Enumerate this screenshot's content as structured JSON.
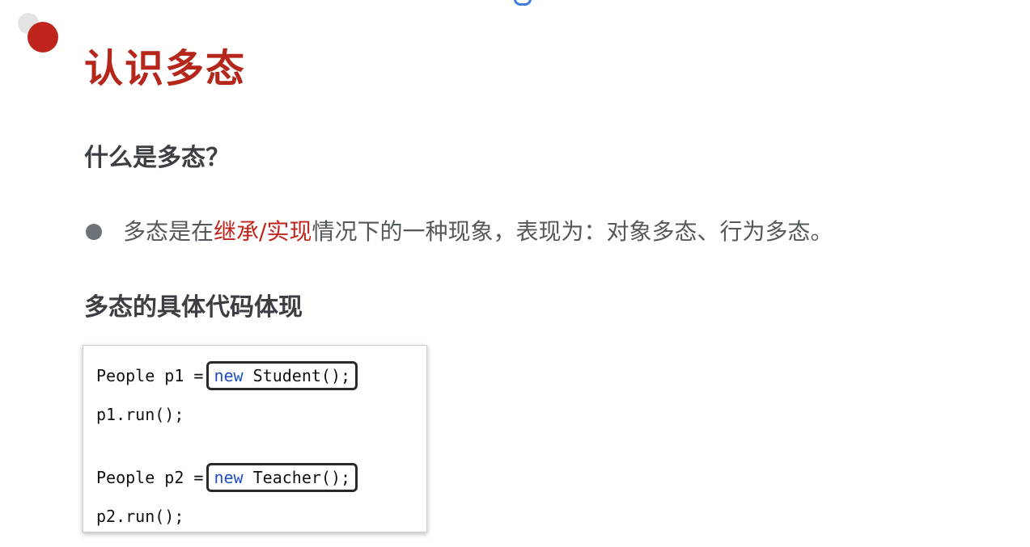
{
  "slide": {
    "title": "认识多态",
    "heading_what": "什么是多态？",
    "bullet": {
      "before": "多态是在",
      "highlight": "继承/实现",
      "after": "情况下的一种现象，表现为：对象多态、行为多态。"
    },
    "heading_code": "多态的具体代码体现"
  },
  "code": {
    "line1_prefix": "People p1 =",
    "line1_keyword": "new",
    "line1_call": " Student();",
    "line2": "p1.run();",
    "line3_prefix": "People p2 =",
    "line3_keyword": "new",
    "line3_call": " Teacher();",
    "line4": "p2.run();"
  },
  "colors": {
    "title": "#b5261b",
    "highlight": "#c0251d",
    "keyword": "#1f4fbf",
    "bullet_dot": "#6e7377"
  }
}
